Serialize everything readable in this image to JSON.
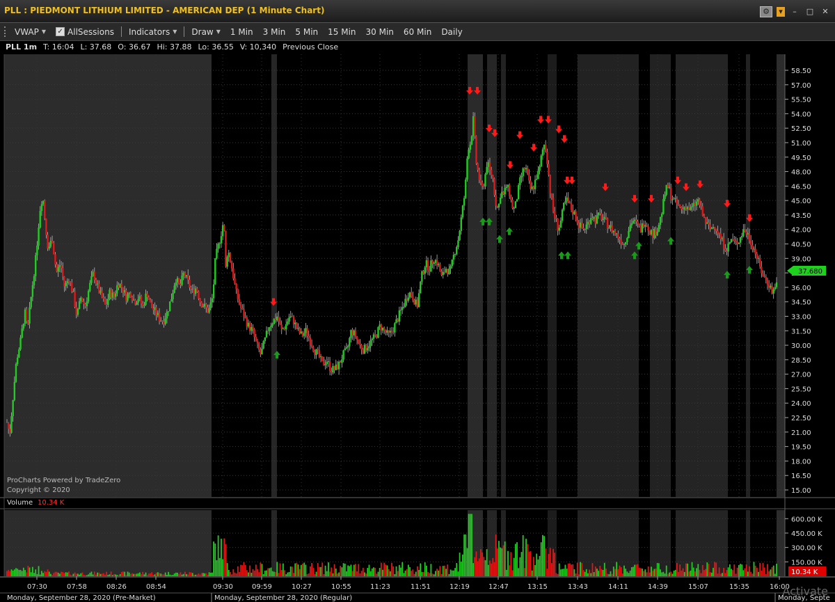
{
  "window": {
    "title": "PLL : PIEDMONT LITHIUM LIMITED - AMERICAN DEP (1 Minute Chart)"
  },
  "toolbar": {
    "vwap": "VWAP",
    "all_sessions": "AllSessions",
    "indicators": "Indicators",
    "draw": "Draw",
    "timeframes": [
      "1 Min",
      "3 Min",
      "5 Min",
      "15 Min",
      "30 Min",
      "60 Min",
      "Daily"
    ]
  },
  "info": {
    "symbol": "PLL 1m",
    "time": "T: 16:04",
    "last": "L: 37.68",
    "open": "O: 36.67",
    "high": "Hi: 37.88",
    "low": "Lo: 36.55",
    "volume": "V: 10,340",
    "prev_close": "Previous Close"
  },
  "watermark": {
    "line1": "ProCharts Powered by TradeZero",
    "line2": "Copyright © 2020"
  },
  "volume_panel": {
    "label": "Volume",
    "value": "10.34 K"
  },
  "last_price_tag": "37.680",
  "os_watermark": "Activate",
  "chart_data": {
    "type": "candlestick",
    "y_ticks": [
      "58.50",
      "57.00",
      "55.50",
      "54.00",
      "52.50",
      "51.00",
      "49.50",
      "48.00",
      "46.50",
      "45.00",
      "43.50",
      "42.00",
      "40.50",
      "39.00",
      "37.50",
      "36.00",
      "34.50",
      "33.00",
      "31.50",
      "30.00",
      "28.50",
      "27.00",
      "25.50",
      "24.00",
      "22.50",
      "21.00",
      "19.50",
      "18.00",
      "16.50",
      "15.00"
    ],
    "ylim": [
      15.0,
      58.5
    ],
    "volume_ticks": [
      "600.00 K",
      "450.00 K",
      "300.00 K",
      "150.00 K"
    ],
    "volume_ylim": [
      0,
      660
    ],
    "x_ticks": [
      "07:30",
      "07:58",
      "08:26",
      "08:54",
      "09:30",
      "09:59",
      "10:27",
      "10:55",
      "11:23",
      "11:51",
      "12:19",
      "12:47",
      "13:15",
      "13:43",
      "14:11",
      "14:39",
      "15:07",
      "15:35",
      "16:00"
    ],
    "session_labels": [
      "Monday, September 28, 2020 (Pre-Market)",
      "Monday, September 28, 2020 (Regular)",
      "Monday, Septe"
    ],
    "price_path": [
      [
        0,
        22.0
      ],
      [
        4,
        20.8
      ],
      [
        8,
        24.0
      ],
      [
        14,
        28.5
      ],
      [
        20,
        30.5
      ],
      [
        26,
        33.5
      ],
      [
        30,
        31.5
      ],
      [
        36,
        35.5
      ],
      [
        42,
        39.0
      ],
      [
        48,
        44.0
      ],
      [
        52,
        45.6
      ],
      [
        56,
        42.5
      ],
      [
        60,
        40.0
      ],
      [
        66,
        41.0
      ],
      [
        72,
        37.5
      ],
      [
        78,
        38.5
      ],
      [
        84,
        36.0
      ],
      [
        90,
        37.0
      ],
      [
        96,
        35.5
      ],
      [
        102,
        33.0
      ],
      [
        108,
        35.0
      ],
      [
        114,
        34.0
      ],
      [
        120,
        36.0
      ],
      [
        126,
        37.5
      ],
      [
        132,
        36.0
      ],
      [
        138,
        35.0
      ],
      [
        144,
        34.0
      ],
      [
        150,
        35.5
      ],
      [
        156,
        35.0
      ],
      [
        162,
        36.5
      ],
      [
        168,
        36.0
      ],
      [
        174,
        35.0
      ],
      [
        180,
        35.5
      ],
      [
        186,
        34.5
      ],
      [
        192,
        35.0
      ],
      [
        198,
        34.0
      ],
      [
        204,
        35.5
      ],
      [
        210,
        34.0
      ],
      [
        216,
        33.5
      ],
      [
        222,
        32.8
      ],
      [
        228,
        32.5
      ],
      [
        234,
        33.5
      ],
      [
        240,
        35.0
      ],
      [
        246,
        37.0
      ],
      [
        252,
        36.0
      ],
      [
        258,
        37.5
      ],
      [
        264,
        36.5
      ],
      [
        270,
        35.5
      ],
      [
        276,
        36.0
      ],
      [
        282,
        34.5
      ],
      [
        288,
        34.0
      ],
      [
        294,
        33.5
      ],
      [
        300,
        35.0
      ],
      [
        304,
        39.0
      ],
      [
        312,
        41.5
      ],
      [
        316,
        43.0
      ],
      [
        319,
        38.0
      ],
      [
        322,
        40.0
      ],
      [
        328,
        38.0
      ],
      [
        334,
        35.5
      ],
      [
        340,
        34.0
      ],
      [
        346,
        33.0
      ],
      [
        352,
        32.0
      ],
      [
        358,
        31.5
      ],
      [
        364,
        30.0
      ],
      [
        370,
        29.0
      ],
      [
        376,
        30.5
      ],
      [
        382,
        32.0
      ],
      [
        388,
        32.5
      ],
      [
        394,
        33.0
      ],
      [
        400,
        31.5
      ],
      [
        406,
        32.0
      ],
      [
        412,
        33.0
      ],
      [
        418,
        32.5
      ],
      [
        424,
        31.5
      ],
      [
        430,
        31.0
      ],
      [
        436,
        31.5
      ],
      [
        442,
        30.5
      ],
      [
        448,
        29.5
      ],
      [
        454,
        29.0
      ],
      [
        460,
        28.0
      ],
      [
        466,
        28.5
      ],
      [
        472,
        27.5
      ],
      [
        478,
        27.5
      ],
      [
        484,
        28.0
      ],
      [
        490,
        29.0
      ],
      [
        496,
        29.5
      ],
      [
        502,
        31.5
      ],
      [
        508,
        31.0
      ],
      [
        514,
        30.0
      ],
      [
        520,
        29.5
      ],
      [
        526,
        30.0
      ],
      [
        532,
        30.5
      ],
      [
        538,
        31.0
      ],
      [
        544,
        32.0
      ],
      [
        550,
        31.5
      ],
      [
        556,
        31.0
      ],
      [
        562,
        31.5
      ],
      [
        568,
        32.5
      ],
      [
        574,
        33.5
      ],
      [
        580,
        34.5
      ],
      [
        586,
        35.5
      ],
      [
        592,
        35.0
      ],
      [
        598,
        34.0
      ],
      [
        604,
        37.0
      ],
      [
        610,
        38.5
      ],
      [
        616,
        38.0
      ],
      [
        622,
        39.0
      ],
      [
        628,
        38.5
      ],
      [
        634,
        37.0
      ],
      [
        640,
        38.0
      ],
      [
        646,
        37.5
      ],
      [
        652,
        39.5
      ],
      [
        658,
        41.0
      ],
      [
        664,
        44.0
      ],
      [
        668,
        46.0
      ],
      [
        672,
        50.5
      ],
      [
        676,
        51.0
      ],
      [
        680,
        53.5
      ],
      [
        684,
        49.0
      ],
      [
        688,
        47.5
      ],
      [
        692,
        46.0
      ],
      [
        696,
        47.0
      ],
      [
        700,
        49.0
      ],
      [
        704,
        48.0
      ],
      [
        708,
        47.5
      ],
      [
        712,
        45.0
      ],
      [
        716,
        44.0
      ],
      [
        720,
        46.0
      ],
      [
        724,
        45.5
      ],
      [
        728,
        46.5
      ],
      [
        732,
        46.0
      ],
      [
        736,
        44.5
      ],
      [
        740,
        44.0
      ],
      [
        744,
        45.5
      ],
      [
        748,
        47.0
      ],
      [
        752,
        48.0
      ],
      [
        756,
        48.5
      ],
      [
        760,
        47.0
      ],
      [
        764,
        46.0
      ],
      [
        768,
        46.5
      ],
      [
        772,
        47.5
      ],
      [
        776,
        48.0
      ],
      [
        780,
        50.0
      ],
      [
        784,
        51.0
      ],
      [
        788,
        49.0
      ],
      [
        792,
        46.0
      ],
      [
        796,
        44.0
      ],
      [
        800,
        43.0
      ],
      [
        804,
        42.0
      ],
      [
        808,
        43.0
      ],
      [
        812,
        44.5
      ],
      [
        816,
        45.0
      ],
      [
        820,
        44.5
      ],
      [
        824,
        44.0
      ],
      [
        828,
        43.5
      ],
      [
        834,
        42.5
      ],
      [
        840,
        42.0
      ],
      [
        846,
        42.5
      ],
      [
        852,
        43.5
      ],
      [
        858,
        43.0
      ],
      [
        864,
        43.5
      ],
      [
        870,
        43.0
      ],
      [
        876,
        42.5
      ],
      [
        882,
        42.0
      ],
      [
        888,
        41.5
      ],
      [
        894,
        41.0
      ],
      [
        900,
        40.5
      ],
      [
        906,
        42.0
      ],
      [
        912,
        43.0
      ],
      [
        918,
        42.5
      ],
      [
        924,
        42.0
      ],
      [
        930,
        43.0
      ],
      [
        936,
        42.0
      ],
      [
        942,
        41.5
      ],
      [
        948,
        42.0
      ],
      [
        954,
        43.5
      ],
      [
        960,
        46.0
      ],
      [
        964,
        46.5
      ],
      [
        968,
        45.5
      ],
      [
        972,
        45.0
      ],
      [
        978,
        44.5
      ],
      [
        984,
        44.0
      ],
      [
        990,
        44.5
      ],
      [
        996,
        44.0
      ],
      [
        1002,
        44.5
      ],
      [
        1008,
        45.0
      ],
      [
        1014,
        43.5
      ],
      [
        1020,
        42.5
      ],
      [
        1026,
        42.0
      ],
      [
        1032,
        42.5
      ],
      [
        1038,
        41.5
      ],
      [
        1044,
        40.5
      ],
      [
        1050,
        40.0
      ],
      [
        1056,
        41.0
      ],
      [
        1062,
        40.5
      ],
      [
        1068,
        41.0
      ],
      [
        1074,
        42.0
      ],
      [
        1080,
        41.5
      ],
      [
        1086,
        40.5
      ],
      [
        1092,
        39.5
      ],
      [
        1098,
        38.0
      ],
      [
        1104,
        37.0
      ],
      [
        1110,
        36.5
      ],
      [
        1116,
        35.5
      ],
      [
        1120,
        36.0
      ],
      [
        1124,
        37.7
      ]
    ],
    "red_arrows": [
      [
        675,
        56.2
      ],
      [
        686,
        56.2
      ],
      [
        703,
        52.3
      ],
      [
        711,
        51.8
      ],
      [
        733,
        48.5
      ],
      [
        747,
        51.6
      ],
      [
        767,
        50.3
      ],
      [
        777,
        53.2
      ],
      [
        788,
        53.2
      ],
      [
        803,
        52.2
      ],
      [
        811,
        51.2
      ],
      [
        815,
        46.9
      ],
      [
        822,
        46.9
      ],
      [
        870,
        46.2
      ],
      [
        912,
        45.0
      ],
      [
        936,
        45.0
      ],
      [
        974,
        46.9
      ],
      [
        986,
        46.2
      ],
      [
        1006,
        46.5
      ],
      [
        1045,
        44.5
      ],
      [
        1077,
        43.0
      ],
      [
        393,
        34.3
      ]
    ],
    "green_arrows": [
      [
        694,
        43.0
      ],
      [
        703,
        43.0
      ],
      [
        718,
        41.2
      ],
      [
        732,
        42.0
      ],
      [
        807,
        39.5
      ],
      [
        816,
        39.5
      ],
      [
        912,
        39.5
      ],
      [
        918,
        40.5
      ],
      [
        964,
        41.0
      ],
      [
        1045,
        37.5
      ],
      [
        1077,
        38.0
      ],
      [
        398,
        29.2
      ]
    ]
  }
}
